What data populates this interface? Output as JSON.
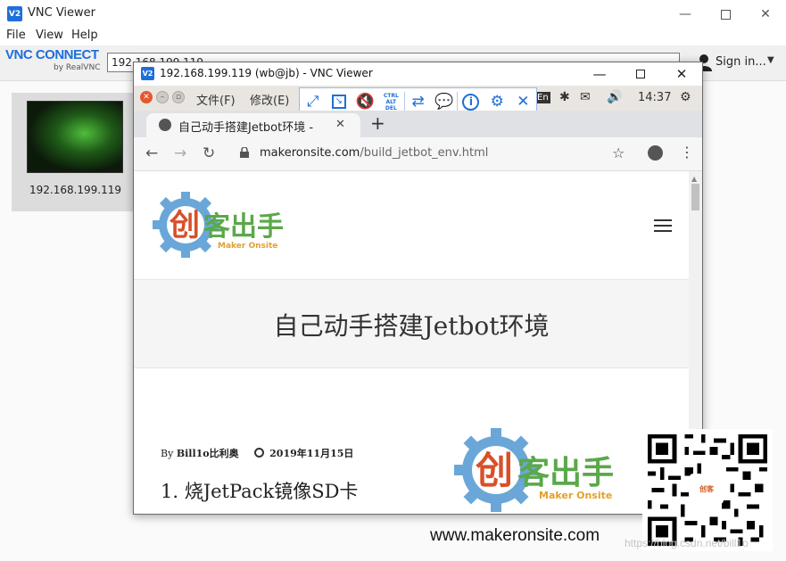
{
  "outer": {
    "title": "VNC Viewer",
    "app_icon": "V2",
    "menu": [
      "File",
      "View",
      "Help"
    ],
    "logo_main": "VNC CONNECT",
    "logo_sub": "by RealVNC",
    "address_value": "192.168.199.119",
    "signin_label": "Sign in...",
    "thumbnail_label": "192.168.199.119"
  },
  "inner": {
    "title": "192.168.199.119 (wb@jb) - VNC Viewer",
    "app_icon": "V2",
    "remote_menu": [
      "文件(F)",
      "修改(E)"
    ],
    "tray_lang": "En",
    "tray_time": "14:37",
    "icons": {
      "fullscreen": "expand-arrows-icon",
      "scale": "scale-icon",
      "speaker": "speaker-off-icon",
      "ctrl_alt_del": "CTRL\nALT\nDEL",
      "transfer": "transfer-icon",
      "chat": "chat-icon",
      "info": "info-icon",
      "settings": "gear-icon",
      "close": "close-icon"
    }
  },
  "browser": {
    "tab_title": "自己动手搭建Jetbot环境 -",
    "url_domain": "makeronsite.com",
    "url_path": "/build_jetbot_env.html"
  },
  "page": {
    "logo_text": "创客出手",
    "logo_sub": "Maker Onsite",
    "title": "自己动手搭建Jetbot环境",
    "author_prefix": "By",
    "author": "Bill1o比利奥",
    "date": "2019年11月15日",
    "section_heading": "1. 烧JetPack镜像SD卡"
  },
  "overlay": {
    "logo_text": "创客出手",
    "logo_sub": "Maker Onsite",
    "site_url": "www.makeronsite.com",
    "watermark": "https://blog.csdn.net/bill1o"
  },
  "colors": {
    "accent_blue": "#1e6fd9",
    "logo_red": "#d8502a",
    "logo_green": "#5ba84a",
    "gear_blue": "#6aa7d8"
  }
}
